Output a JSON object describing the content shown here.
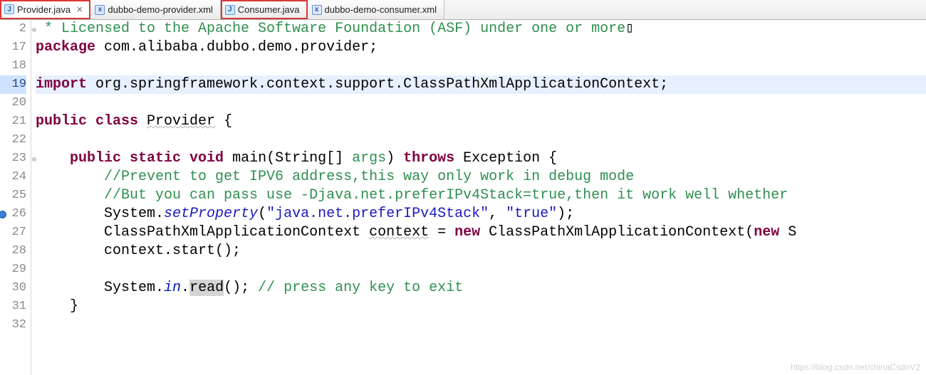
{
  "tabs": [
    {
      "label": "Provider.java",
      "kind": "java",
      "active": true,
      "highlight": true,
      "closeable": true
    },
    {
      "label": "dubbo-demo-provider.xml",
      "kind": "xml",
      "active": false,
      "highlight": false,
      "closeable": false
    },
    {
      "label": "Consumer.java",
      "kind": "java",
      "active": false,
      "highlight": true,
      "closeable": false
    },
    {
      "label": "dubbo-demo-consumer.xml",
      "kind": "xml",
      "active": false,
      "highlight": false,
      "closeable": false
    }
  ],
  "gutter": {
    "numbers": [
      "2",
      "17",
      "18",
      "19",
      "20",
      "21",
      "22",
      "23",
      "24",
      "25",
      "26",
      "27",
      "28",
      "29",
      "30",
      "31",
      "32"
    ],
    "highlight_index": 3,
    "fold_indices": [
      0,
      7
    ],
    "breakpoint_indices": [
      10
    ]
  },
  "code": {
    "rows": [
      {
        "segments": [
          {
            "t": " * Licensed to the Apache Software Foundation (ASF) under one or more",
            "cls": "cm"
          },
          {
            "t": "▯",
            "cls": ""
          }
        ]
      },
      {
        "segments": [
          {
            "t": "package",
            "cls": "kw"
          },
          {
            "t": " com.alibaba.dubbo.demo.provider;",
            "cls": ""
          }
        ]
      },
      {
        "segments": []
      },
      {
        "hl": true,
        "segments": [
          {
            "t": "import",
            "cls": "kw"
          },
          {
            "t": " org.springframework.context.support.ClassPathXmlApplicationContext;",
            "cls": ""
          }
        ]
      },
      {
        "segments": []
      },
      {
        "segments": [
          {
            "t": "public class",
            "cls": "kw"
          },
          {
            "t": " ",
            "cls": ""
          },
          {
            "t": "Provider",
            "cls": "ul"
          },
          {
            "t": " {",
            "cls": ""
          }
        ]
      },
      {
        "segments": []
      },
      {
        "segments": [
          {
            "t": "    ",
            "cls": ""
          },
          {
            "t": "public static void",
            "cls": "kw"
          },
          {
            "t": " main(String[] ",
            "cls": ""
          },
          {
            "t": "args",
            "cls": "cm"
          },
          {
            "t": ") ",
            "cls": ""
          },
          {
            "t": "throws",
            "cls": "kw"
          },
          {
            "t": " Exception {",
            "cls": ""
          }
        ]
      },
      {
        "segments": [
          {
            "t": "        ",
            "cls": ""
          },
          {
            "t": "//Prevent to get IPV6 address,this way only work in debug mode",
            "cls": "cm"
          }
        ]
      },
      {
        "segments": [
          {
            "t": "        ",
            "cls": ""
          },
          {
            "t": "//But you can pass use -Djava.net.preferIPv4Stack=true,then it work well whether",
            "cls": "cm"
          }
        ]
      },
      {
        "segments": [
          {
            "t": "        System.",
            "cls": ""
          },
          {
            "t": "setProperty",
            "cls": "mi"
          },
          {
            "t": "(",
            "cls": ""
          },
          {
            "t": "\"java.net.preferIPv4Stack\"",
            "cls": "str"
          },
          {
            "t": ", ",
            "cls": ""
          },
          {
            "t": "\"true\"",
            "cls": "str"
          },
          {
            "t": ");",
            "cls": ""
          }
        ]
      },
      {
        "segments": [
          {
            "t": "        ClassPathXmlApplicationContext ",
            "cls": ""
          },
          {
            "t": "context",
            "cls": "ul"
          },
          {
            "t": " = ",
            "cls": ""
          },
          {
            "t": "new",
            "cls": "kw"
          },
          {
            "t": " ClassPathXmlApplicationContext(",
            "cls": ""
          },
          {
            "t": "new",
            "cls": "kw"
          },
          {
            "t": " S",
            "cls": ""
          }
        ]
      },
      {
        "segments": [
          {
            "t": "        context.start();",
            "cls": ""
          }
        ]
      },
      {
        "segments": []
      },
      {
        "segments": [
          {
            "t": "        System.",
            "cls": ""
          },
          {
            "t": "in",
            "cls": "fld"
          },
          {
            "t": ".",
            "cls": ""
          },
          {
            "t": "read",
            "cls": "sel"
          },
          {
            "t": "(); ",
            "cls": ""
          },
          {
            "t": "// press any key to exit",
            "cls": "cm"
          }
        ]
      },
      {
        "segments": [
          {
            "t": "    }",
            "cls": ""
          }
        ]
      },
      {
        "segments": []
      }
    ]
  },
  "watermark": "https://blog.csdn.net/chinaCsdnV2"
}
